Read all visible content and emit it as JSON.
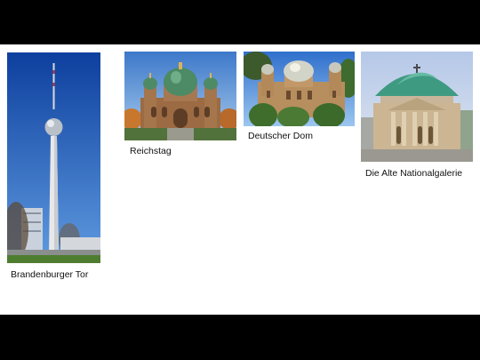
{
  "slide": {
    "items": [
      {
        "caption": "Brandenburger Tor",
        "photo": "tv-tower-photo"
      },
      {
        "caption": "Reichstag",
        "photo": "cathedral-photo"
      },
      {
        "caption": "Deutscher Dom",
        "photo": "synagogue-photo"
      },
      {
        "caption": "Die Alte Nationalgalerie",
        "photo": "domed-church-photo"
      }
    ]
  }
}
